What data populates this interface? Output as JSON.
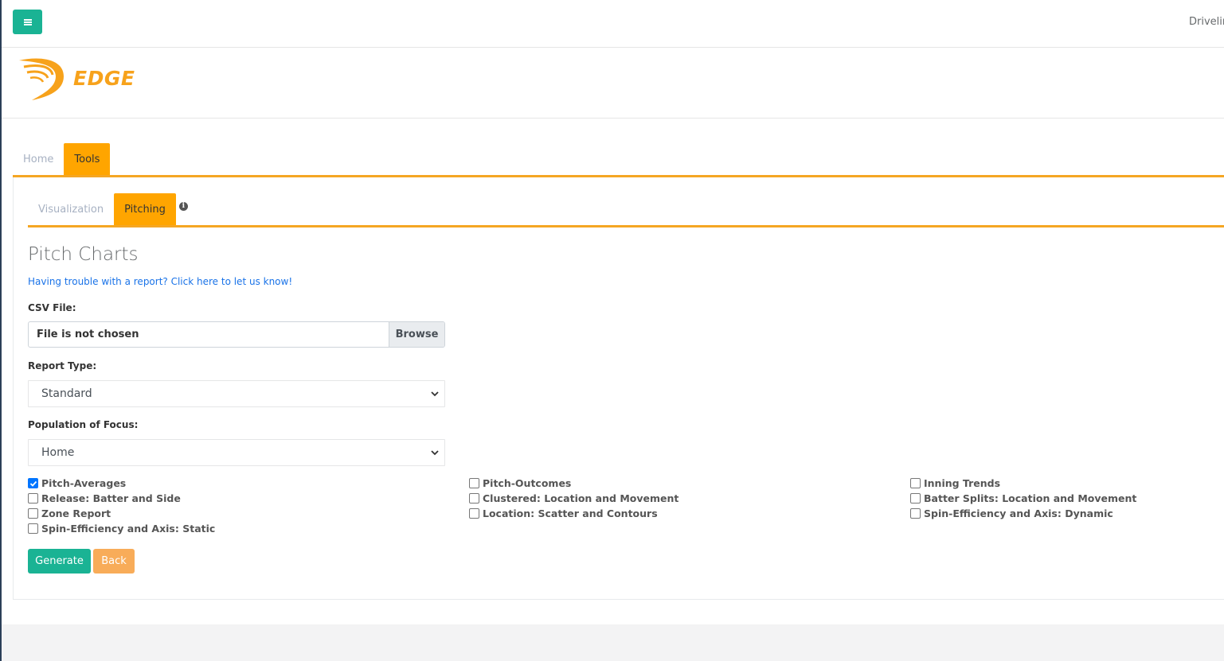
{
  "topbar": {
    "menu_icon": "hamburger-icon",
    "user_label": "Driveline"
  },
  "logo": {
    "text": "EDGE",
    "color": "#f7a21b"
  },
  "main_tabs": [
    {
      "label": "Home",
      "active": false
    },
    {
      "label": "Tools",
      "active": true
    }
  ],
  "sub_tabs": [
    {
      "label": "Visualization",
      "active": false
    },
    {
      "label": "Pitching",
      "active": true
    }
  ],
  "page": {
    "title": "Pitch Charts",
    "help_link": "Having trouble with a report? Click here to let us know!"
  },
  "form": {
    "csv_label": "CSV File:",
    "file_value": "File is not chosen",
    "browse_label": "Browse",
    "report_type_label": "Report Type:",
    "report_type_value": "Standard",
    "population_label": "Population of Focus:",
    "population_value": "Home"
  },
  "checkboxes": [
    {
      "label": "Pitch-Averages",
      "checked": true
    },
    {
      "label": "Release: Batter and Side",
      "checked": false
    },
    {
      "label": "Zone Report",
      "checked": false
    },
    {
      "label": "Spin-Efficiency and Axis: Static",
      "checked": false
    },
    {
      "label": "Pitch-Outcomes",
      "checked": false
    },
    {
      "label": "Clustered: Location and Movement",
      "checked": false
    },
    {
      "label": "Location: Scatter and Contours",
      "checked": false
    },
    {
      "label": "Inning Trends",
      "checked": false
    },
    {
      "label": "Batter Splits: Location and Movement",
      "checked": false
    },
    {
      "label": "Spin-Efficiency and Axis: Dynamic",
      "checked": false
    }
  ],
  "buttons": {
    "generate": "Generate",
    "back": "Back"
  },
  "colors": {
    "accent_orange": "#ffa500",
    "primary_green": "#1ab394",
    "back_orange": "#f8ac59",
    "link_blue": "#1a73e8"
  }
}
